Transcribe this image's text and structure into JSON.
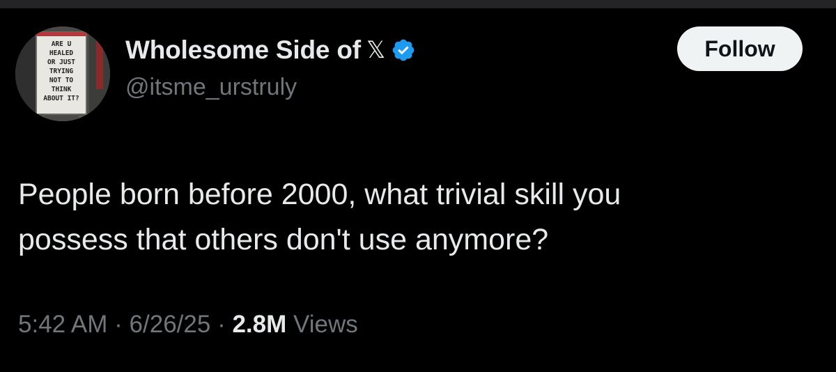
{
  "profile": {
    "display_name": "Wholesome Side of",
    "x_symbol": "𝕏",
    "verified_icon": "verified-badge-icon",
    "handle": "@itsme_urstruly",
    "avatar_sign_lines": [
      "ARE U",
      "HEALED",
      "OR JUST",
      "TRYING",
      "NOT TO",
      "THINK",
      "ABOUT IT?"
    ]
  },
  "actions": {
    "follow_label": "Follow"
  },
  "tweet": {
    "lines": [
      "People born before 2000, what trivial skill you",
      "possess that others don't use anymore?"
    ]
  },
  "meta": {
    "time": "5:42 AM",
    "separator": "·",
    "date": "6/26/25",
    "views_count": "2.8M",
    "views_label": "Views"
  },
  "colors": {
    "background": "#000000",
    "primary_text": "#e7e9ea",
    "secondary_text": "#71767b",
    "verified_blue": "#1d9bf0",
    "follow_bg": "#eff3f4"
  }
}
